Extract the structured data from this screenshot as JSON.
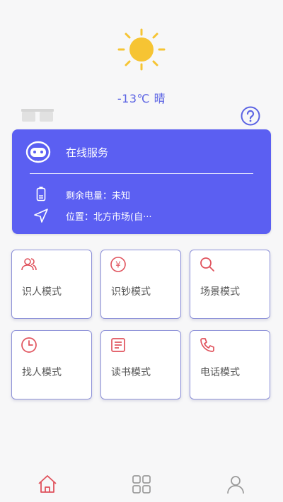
{
  "weather": {
    "text": "-13℃ 晴",
    "icon": "sun-icon"
  },
  "header": {
    "glasses_icon": "glasses-icon",
    "help_icon": "help-question-icon"
  },
  "service": {
    "title": "在线服务",
    "battery_label": "剩余电量：未知",
    "location_label": "位置：北方市场(自···",
    "colors": {
      "card_bg": "#5b5ff2",
      "text": "#ffffff"
    }
  },
  "modes": [
    {
      "label": "识人模式",
      "icon": "people-icon"
    },
    {
      "label": "识钞模式",
      "icon": "yen-money-icon"
    },
    {
      "label": "场景模式",
      "icon": "search-icon"
    },
    {
      "label": "找人模式",
      "icon": "clock-icon"
    },
    {
      "label": "读书模式",
      "icon": "document-lines-icon"
    },
    {
      "label": "电话模式",
      "icon": "phone-icon"
    }
  ],
  "bottom_nav": {
    "items": [
      {
        "name": "home",
        "icon": "home-icon",
        "active": true
      },
      {
        "name": "apps",
        "icon": "grid-icon",
        "active": false
      },
      {
        "name": "profile",
        "icon": "user-icon",
        "active": false
      }
    ],
    "colors": {
      "active": "#e0525c",
      "inactive": "#999999"
    }
  },
  "colors": {
    "accent": "#5b63e3",
    "tile_icon": "#e0525c",
    "tile_border": "#8d91d8"
  }
}
